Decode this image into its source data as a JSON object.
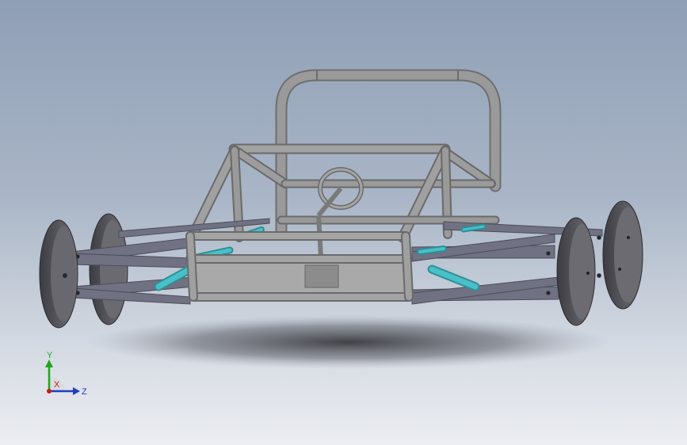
{
  "view": {
    "background_top": "#8f9fb6",
    "background_bottom": "#eceef2",
    "frame_tube_color": "#8f8f8f",
    "control_arm_color": "#6f7081",
    "shock_color": "#3fb7bf",
    "wheel_color": "#4e4e54"
  },
  "triad": {
    "y_label": "Y",
    "z_label": "Z",
    "x_label": "X",
    "y_color": "#22a322",
    "z_color": "#1f3fbf",
    "x_color": "#c01f1f"
  }
}
